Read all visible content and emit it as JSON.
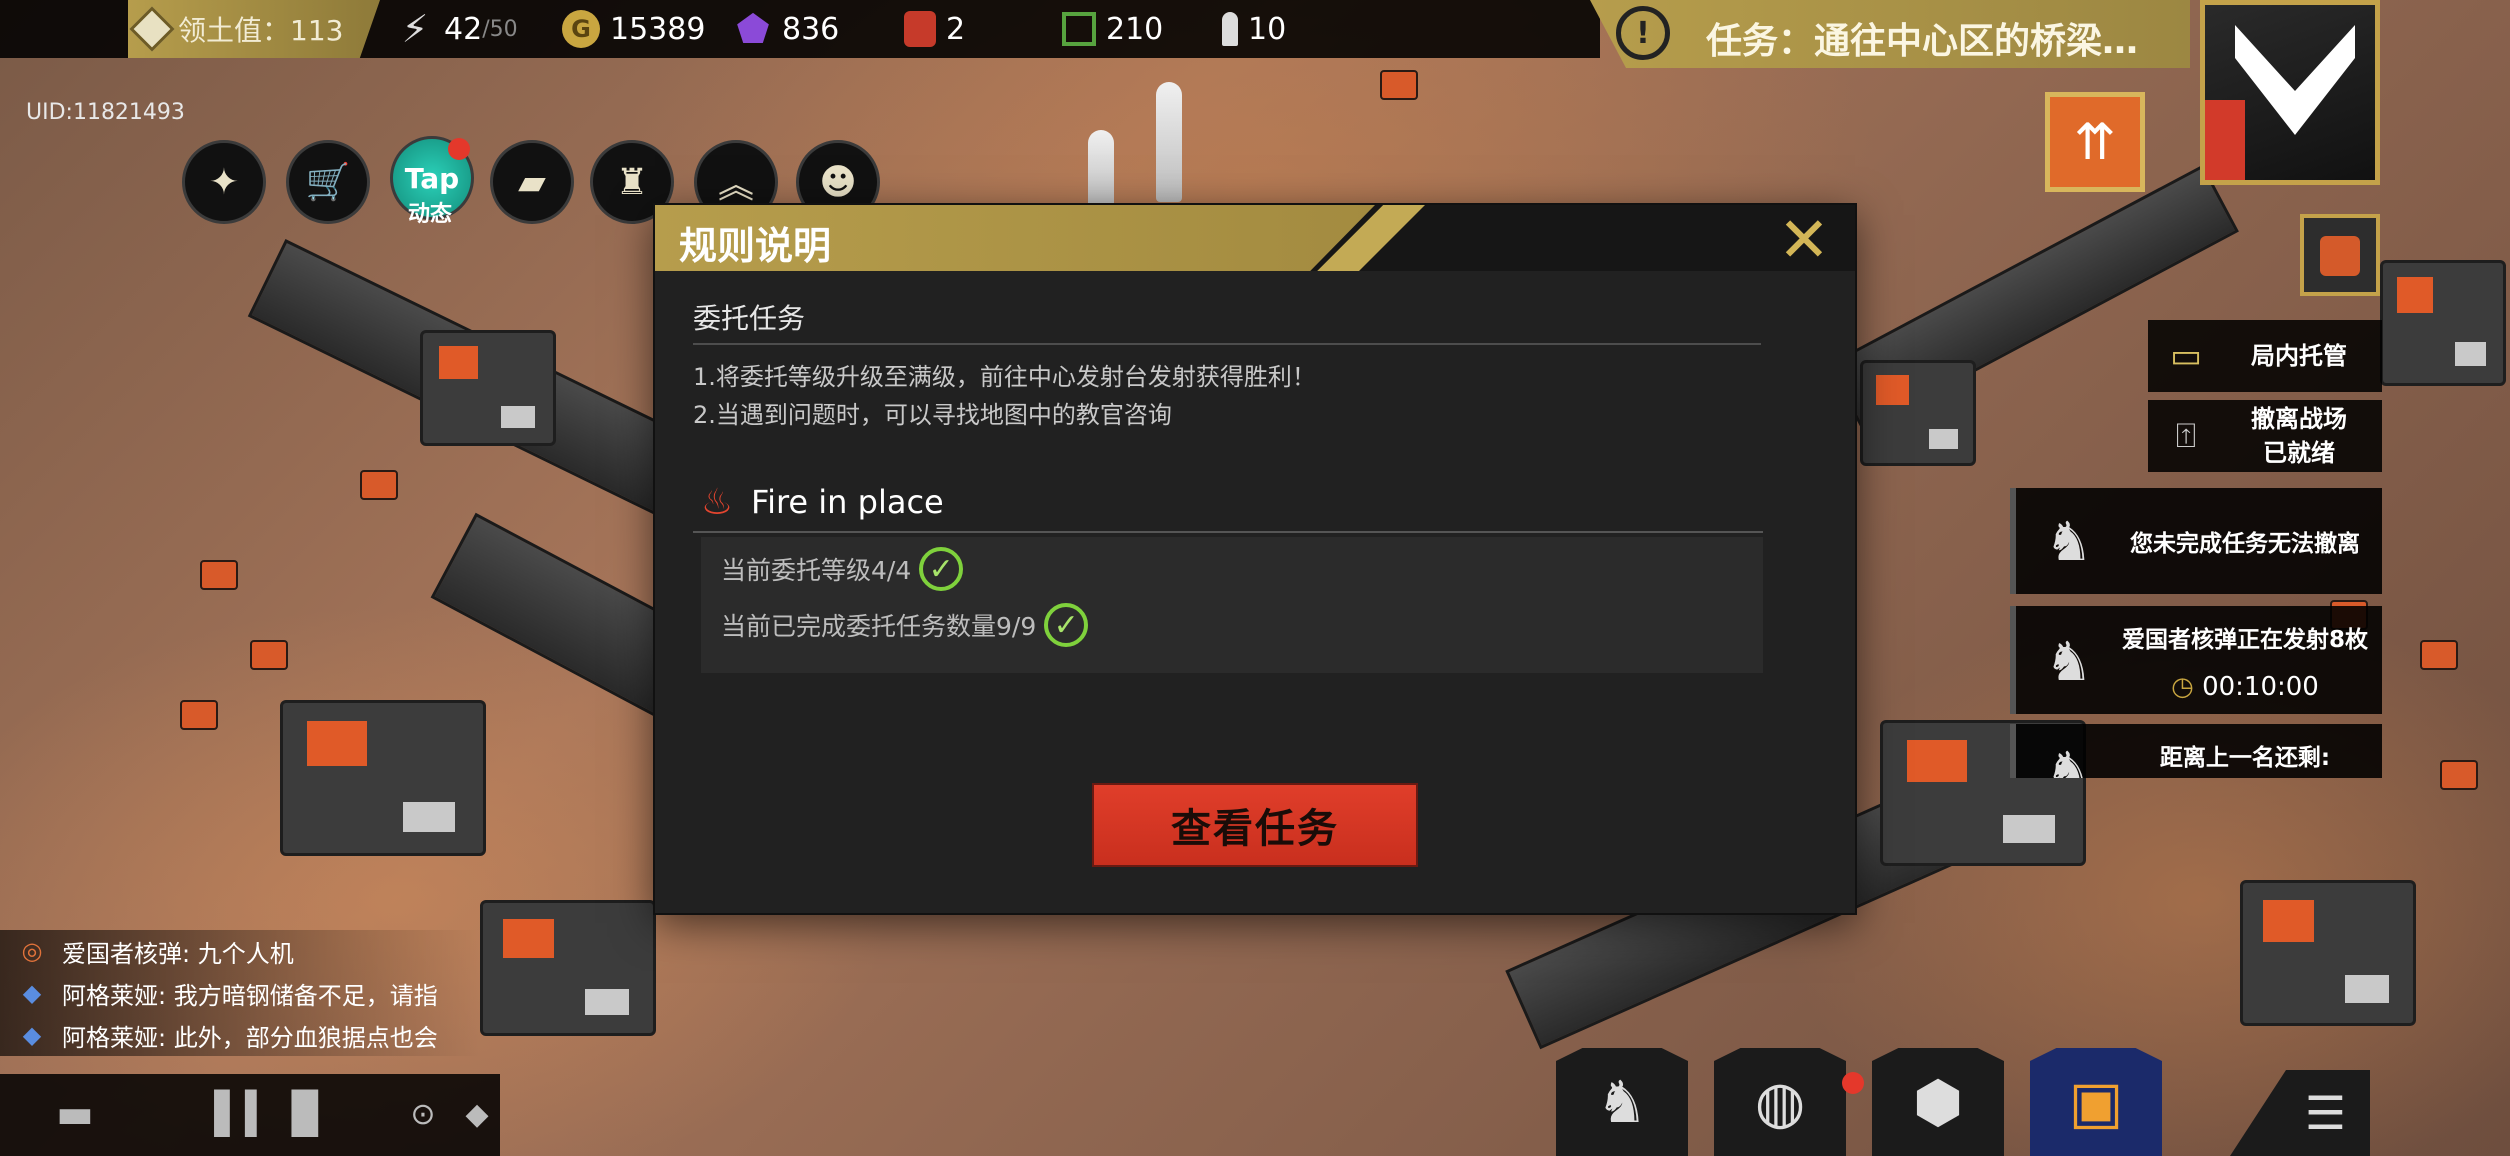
{
  "topbar": {
    "territory_label": "领土值：113",
    "energy_value": "42",
    "energy_max": "/50",
    "gold": "15389",
    "crystal": "836",
    "fuel": "2",
    "chips": "210",
    "ammo": "10",
    "mission_label": "任务：通往中心区的桥梁…"
  },
  "uid": "UID:11821493",
  "toolbar": {
    "tap_label": "动态",
    "tap_text": "Tap"
  },
  "side_panel": {
    "hosting_label": "局内托管",
    "evacuate_line1": "撤离战场",
    "evacuate_line2": "已就绪",
    "task_cards": [
      {
        "text": "您未完成任务无法撤离"
      },
      {
        "text": "爱国者核弹正在发射8枚",
        "timer": "00:10:00"
      },
      {
        "text": "距离上一名还剩:"
      }
    ]
  },
  "chat": [
    {
      "text": "爱国者核弹: 九个人机"
    },
    {
      "text": "阿格莱娅: 我方暗钢储备不足，请指"
    },
    {
      "text": "阿格莱娅: 此外，部分血狼据点也会"
    }
  ],
  "dialog": {
    "title": "规则说明",
    "section": "委托任务",
    "rules": [
      "1.将委托等级升级至满级，前往中心发射台发射获得胜利！",
      "2.当遇到问题时，可以寻找地图中的教官咨询"
    ],
    "subtitle": "Fire in place",
    "conditions": [
      "当前委托等级4/4",
      "当前已完成委托任务数量9/9"
    ],
    "button_label": "查看任务"
  },
  "colors": {
    "gold": "#b69d4c",
    "button_red": "#e03e2a",
    "check_green": "#7fd13c"
  }
}
